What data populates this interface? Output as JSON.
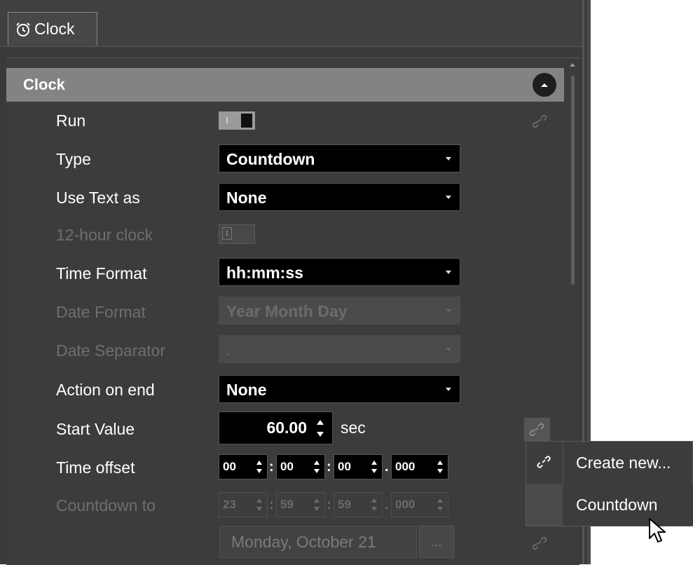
{
  "tab": {
    "label": "Clock",
    "icon": "alarm-clock-icon"
  },
  "section": {
    "title": "Clock",
    "collapse_icon": "chevron-up-icon"
  },
  "rows": {
    "run": {
      "label": "Run",
      "value": "on"
    },
    "type": {
      "label": "Type",
      "value": "Countdown"
    },
    "use_text_as": {
      "label": "Use Text as",
      "value": "None"
    },
    "twelve_hour": {
      "label": "12-hour clock",
      "value": "off"
    },
    "time_format": {
      "label": "Time Format",
      "value": "hh:mm:ss"
    },
    "date_format": {
      "label": "Date Format",
      "value": "Year Month Day"
    },
    "date_separator": {
      "label": "Date Separator",
      "value": "."
    },
    "action_on_end": {
      "label": "Action on end",
      "value": "None"
    },
    "start_value": {
      "label": "Start Value",
      "value": "60.00",
      "unit": "sec"
    },
    "time_offset": {
      "label": "Time offset",
      "h": "00",
      "m": "00",
      "s": "00",
      "ms": "000"
    },
    "countdown_to": {
      "label": "Countdown to",
      "h": "23",
      "m": "59",
      "s": "59",
      "ms": "000"
    },
    "countdown_date": {
      "value": "Monday, October 21",
      "button": "..."
    }
  },
  "popup": {
    "items": [
      {
        "label": "Create new...",
        "icon": "link-icon"
      },
      {
        "label": "Countdown"
      }
    ]
  },
  "colors": {
    "panel": "#3a3a3a",
    "header": "#838383",
    "field": "#000000"
  }
}
